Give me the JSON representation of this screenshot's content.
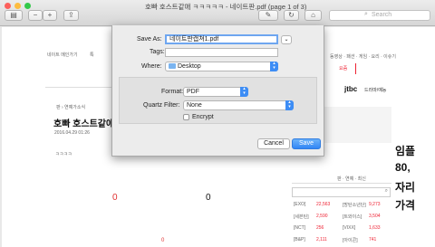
{
  "window": {
    "title": "호빠 호스트같애 ㅋㅋㅋㅋㅋ - 네이트판.pdf (page 1 of 3)"
  },
  "toolbar": {
    "search_placeholder": "Search"
  },
  "dialog": {
    "save_as_label": "Save As:",
    "save_as_value": "네이트판캡쳐1.pdf",
    "tags_label": "Tags:",
    "where_label": "Where:",
    "where_value": "Desktop",
    "format_label": "Format:",
    "format_value": "PDF",
    "quartz_label": "Quartz Filter:",
    "quartz_value": "None",
    "encrypt_label": "Encrypt",
    "cancel_label": "Cancel",
    "save_label": "Save"
  },
  "page": {
    "nav_left": "네이트 메인가기",
    "nav_mid": "톡",
    "nav_links": "동영상 · 패션 · 게임 · 요리 · 이슈기",
    "nav_red": "요즘",
    "crumb": "판 › 연예가소식",
    "headline": "호빠 호스트같애 ㅋ",
    "date": "2016.04.29 01:26",
    "dots": "ㅋㅋㅋㅋ",
    "zero_red": "0",
    "zero_black": "0",
    "zero_small": "0",
    "ad_logo": "jtbc",
    "ad_text": "드라마/예능",
    "big_text": [
      "임플",
      "80,",
      "자리",
      "가격"
    ],
    "list_header": "판 · 연예 · 최신",
    "stocks": [
      {
        "name": "[EXO]",
        "val": "22,563",
        "name2": "[방탄소년단]",
        "val2": "9,273"
      },
      {
        "name": "[세븐틴]",
        "val": "2,590",
        "name2": "[트와이스]",
        "val2": "3,504"
      },
      {
        "name": "[NCT]",
        "val": "256",
        "name2": "[VIXX]",
        "val2": "1,633"
      },
      {
        "name": "[B&P]",
        "val": "2,111",
        "name2": "[아이콘]",
        "val2": "741"
      }
    ]
  }
}
